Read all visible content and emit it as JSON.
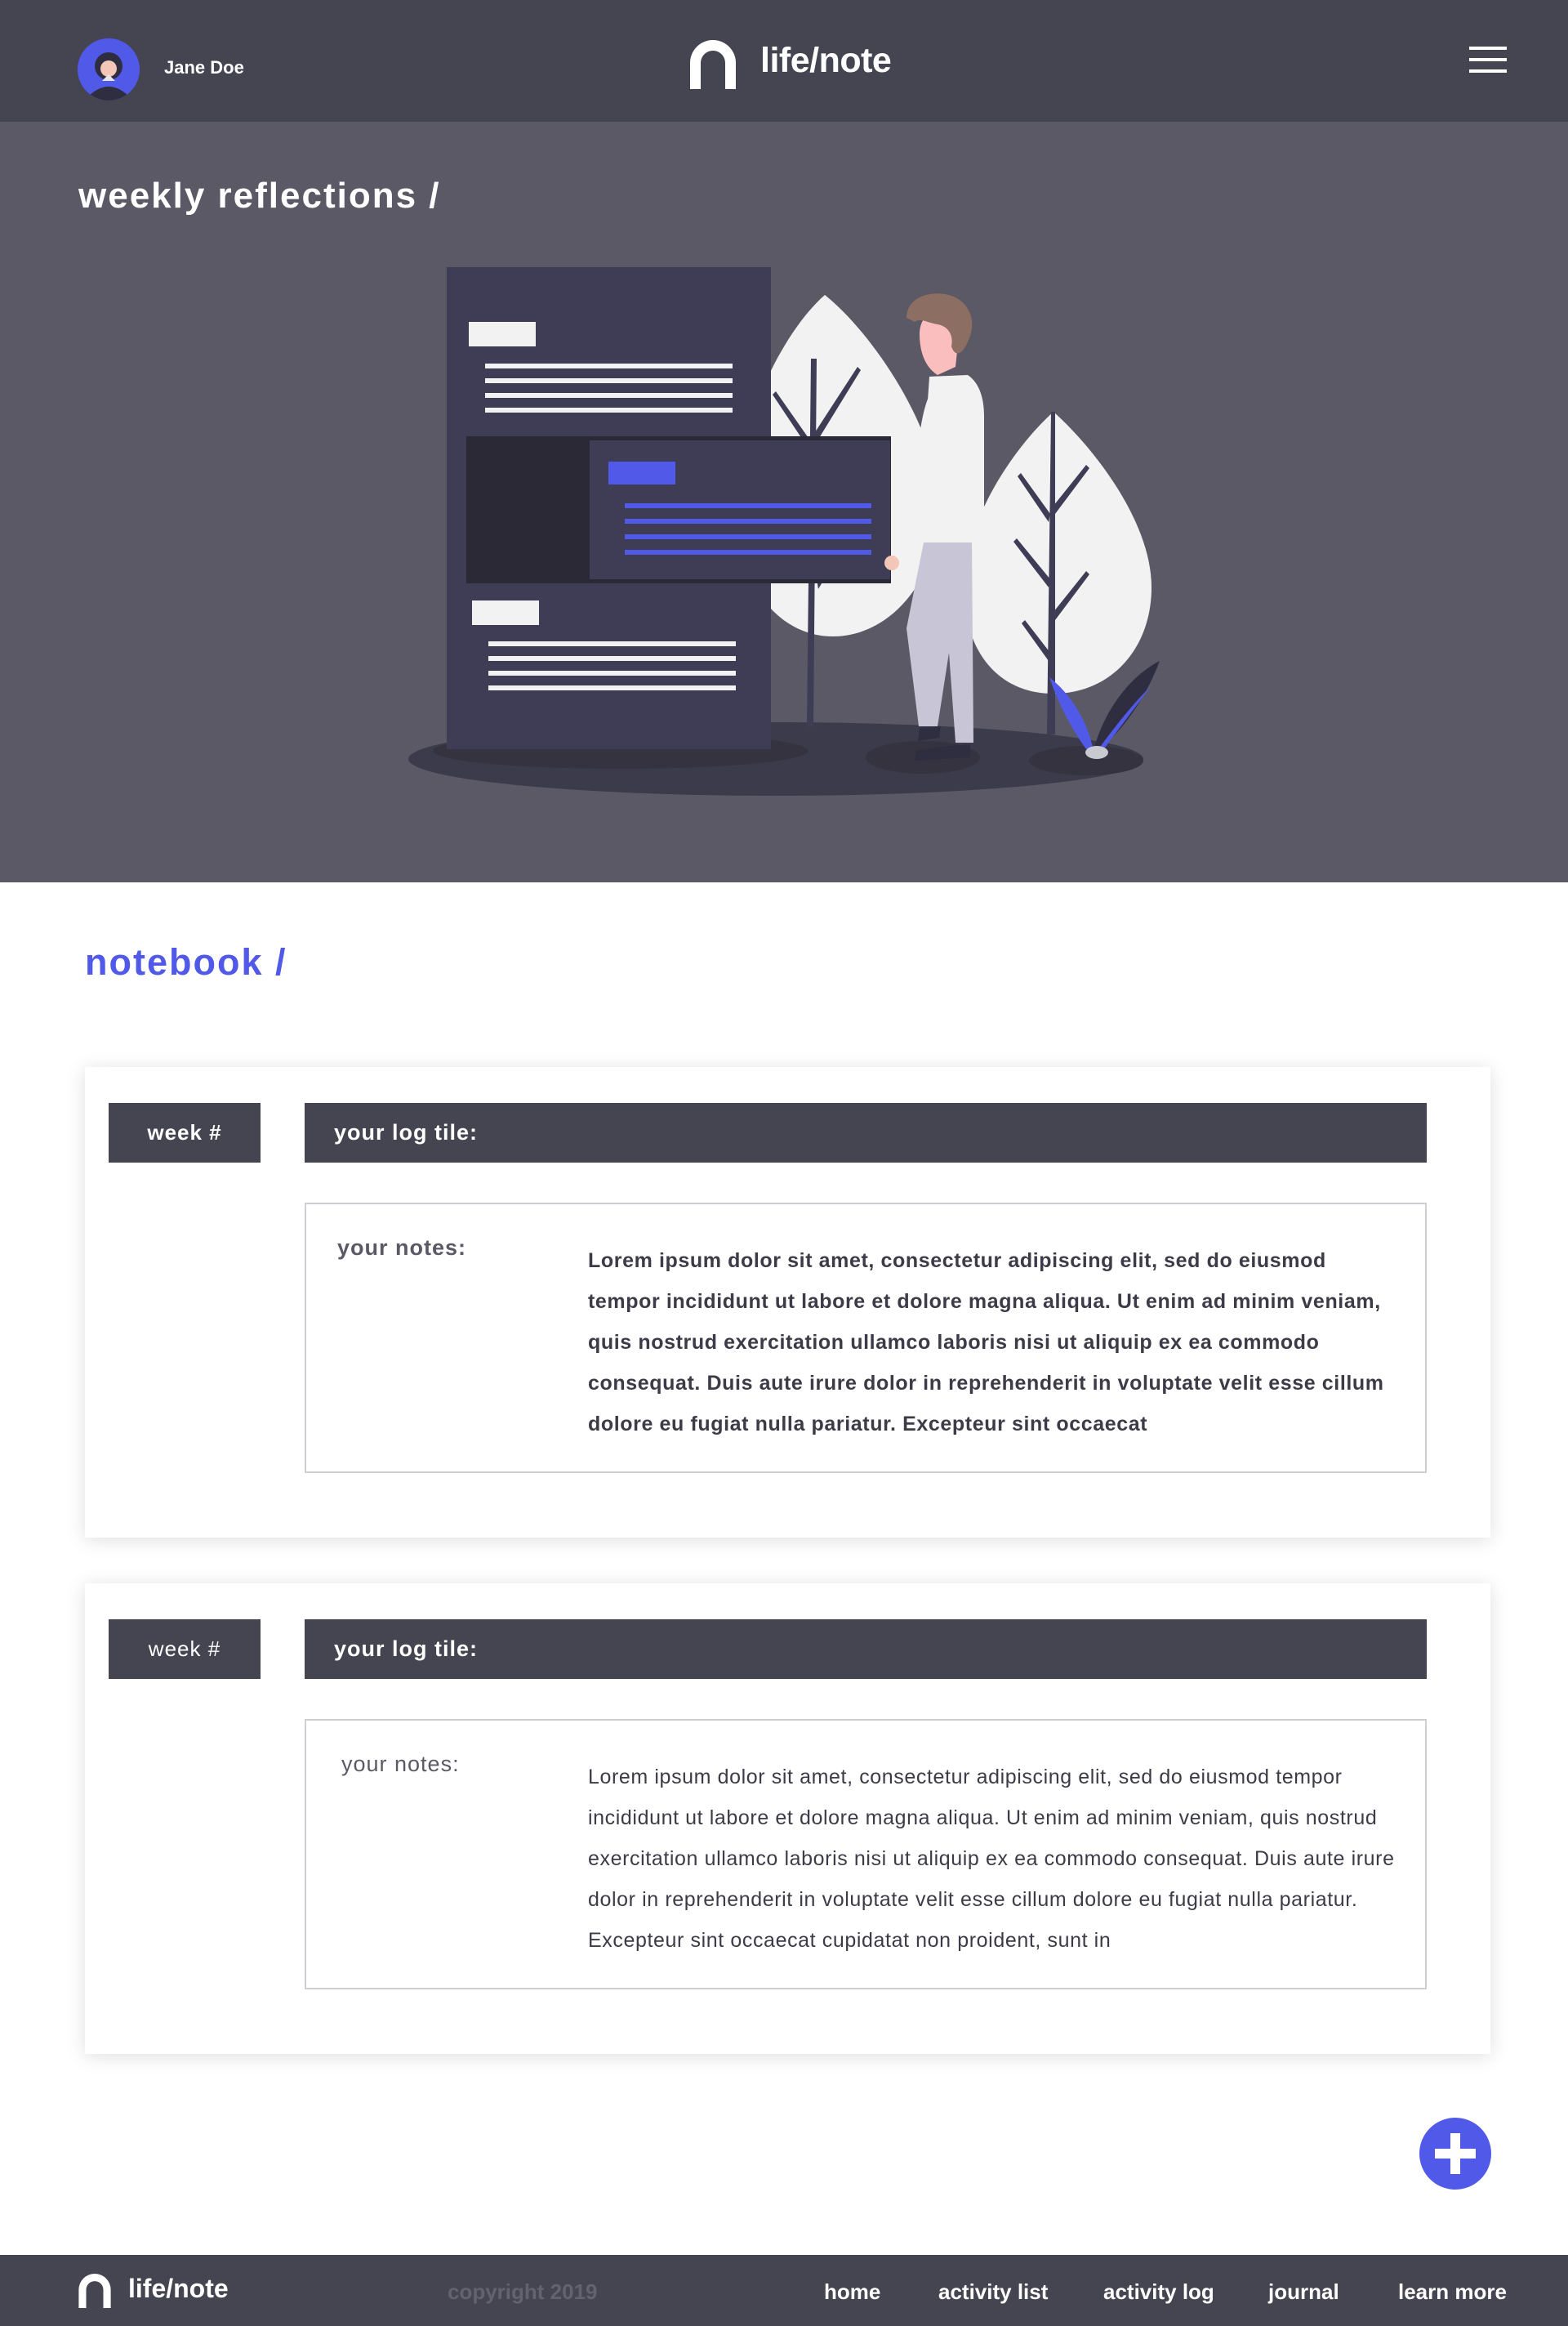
{
  "header": {
    "user_name": "Jane Doe",
    "brand": "life/note",
    "avatar_icon": "user-avatar-icon",
    "menu_icon": "hamburger-menu-icon"
  },
  "hero": {
    "title": "weekly reflections /"
  },
  "notebook": {
    "title": "notebook /",
    "entries": [
      {
        "week_label": "week #",
        "log_title": "your log tile:",
        "notes_label": "your notes:",
        "notes_text": "Lorem ipsum dolor sit amet, consectetur adipiscing elit, sed do eiusmod tempor incididunt ut labore et dolore magna aliqua. Ut enim ad minim veniam, quis nostrud exercitation ullamco laboris nisi ut aliquip ex ea commodo consequat. Duis aute irure dolor in reprehenderit in voluptate velit esse cillum dolore eu fugiat nulla pariatur. Excepteur sint occaecat"
      },
      {
        "week_label": "week #",
        "log_title": "your log tile:",
        "notes_label": "your notes:",
        "notes_text": "Lorem ipsum dolor sit amet, consectetur adipiscing elit, sed do eiusmod tempor incididunt ut labore et dolore magna aliqua. Ut enim ad minim veniam, quis nostrud exercitation ullamco laboris nisi ut aliquip ex ea commodo consequat. Duis aute irure dolor in reprehenderit in voluptate velit esse cillum dolore eu fugiat nulla pariatur. Excepteur sint occaecat cupidatat non proident, sunt in"
      }
    ]
  },
  "fab": {
    "icon": "plus-icon"
  },
  "footer": {
    "brand": "life/note",
    "copyright": "copyright 2019",
    "nav": [
      "home",
      "activity list",
      "activity log",
      "journal",
      "learn more"
    ]
  },
  "colors": {
    "header_bg": "#454451",
    "hero_bg": "#5a5965",
    "accent": "#5159e8",
    "text_dark": "#3c3b47"
  }
}
